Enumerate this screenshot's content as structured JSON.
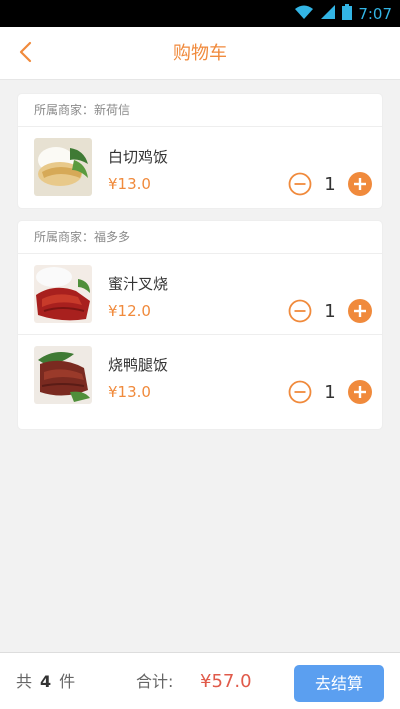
{
  "status_bar": {
    "time": "7:07"
  },
  "header": {
    "title": "购物车"
  },
  "shops": [
    {
      "merchant": "所属商家：新荷信",
      "items": [
        {
          "name": "白切鸡饭",
          "price": "¥13.0",
          "qty": "1",
          "image": "chicken-rice-photo"
        }
      ]
    },
    {
      "merchant": "所属商家：福多多",
      "items": [
        {
          "name": "蜜汁叉烧",
          "price": "¥12.0",
          "qty": "1",
          "image": "char-siu-photo"
        },
        {
          "name": "烧鸭腿饭",
          "price": "¥13.0",
          "qty": "1",
          "image": "roast-duck-rice-photo"
        }
      ]
    }
  ],
  "summary": {
    "count_prefix": "共",
    "count": "4",
    "count_suffix": "件",
    "total_label": "合计:",
    "total_value": "¥57.0",
    "checkout_label": "去结算"
  },
  "colors": {
    "accent": "#f08a3c",
    "price_total": "#e05a4a",
    "checkout_button": "#5b9ff0"
  }
}
